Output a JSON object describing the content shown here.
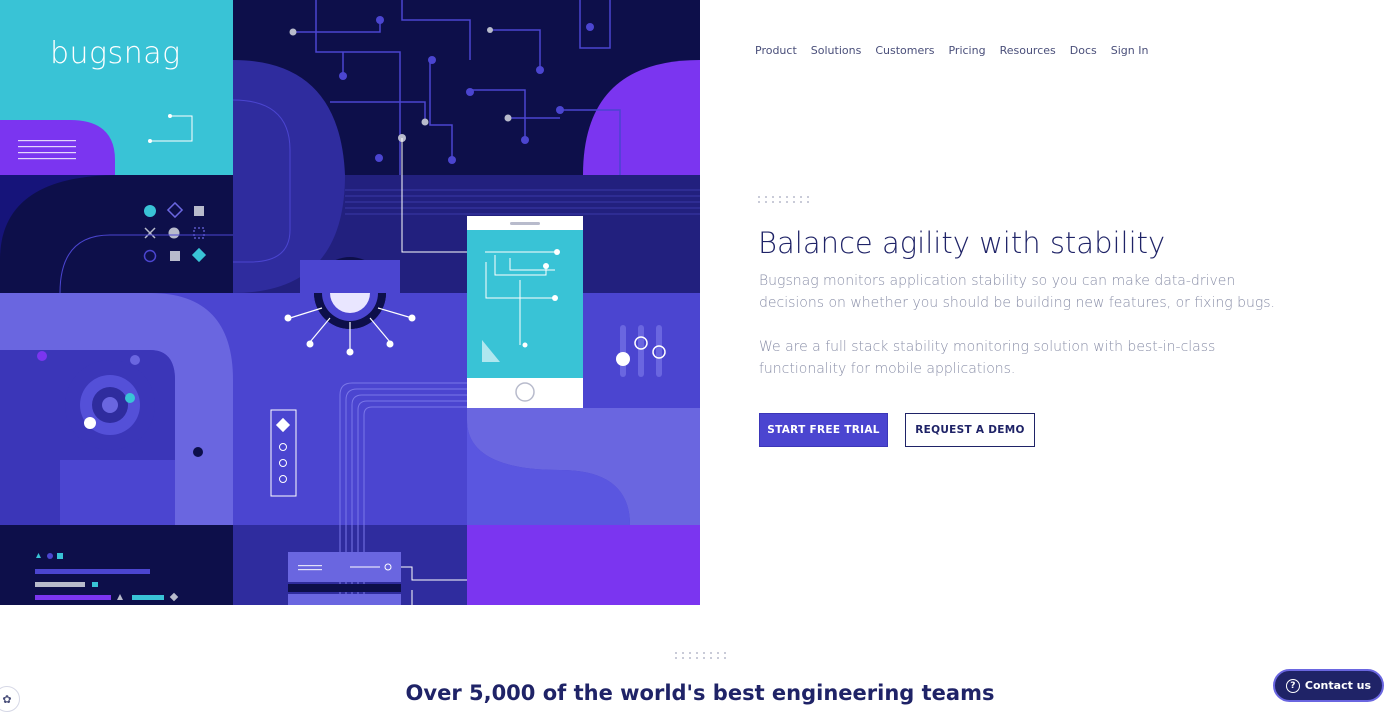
{
  "brand": {
    "logo_text": "bugsnag"
  },
  "nav": {
    "items": [
      "Product",
      "Solutions",
      "Customers",
      "Pricing",
      "Resources",
      "Docs",
      "Sign In"
    ]
  },
  "hero": {
    "headline": "Balance agility with stability",
    "paragraph_1": "Bugsnag monitors application stability so you can make data-driven decisions on whether you should be building new features, or fixing bugs.",
    "paragraph_2": "We are a full stack stability monitoring solution with best-in-class functionality for mobile applications.",
    "primary_button": "START FREE TRIAL",
    "secondary_button": "REQUEST A DEMO"
  },
  "social_proof": {
    "heading": "Over 5,000 of the world's best engineering teams"
  },
  "contact": {
    "label": "Contact us",
    "icon": "question-circle-icon"
  },
  "colors": {
    "navy": "#1f2367",
    "accent": "#4b45d0",
    "cyan": "#39c3d6",
    "purple": "#7b35f0",
    "dark_navy": "#0d0f4a"
  }
}
